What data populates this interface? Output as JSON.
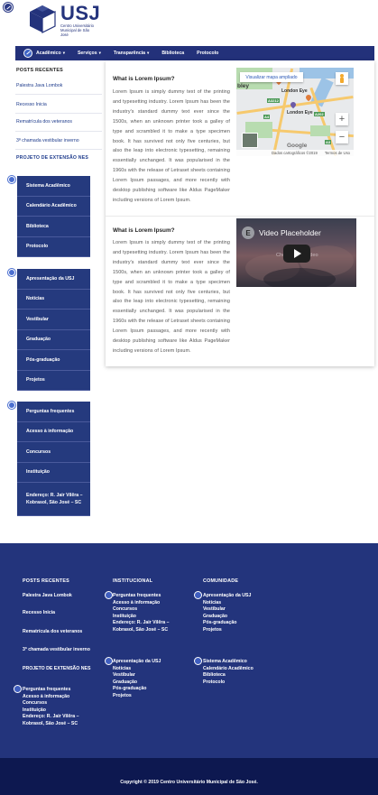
{
  "logo": {
    "abbr": "USJ",
    "sub": "Centro Universitário Municipal de São José"
  },
  "nav": {
    "items": [
      {
        "label": "Acadêmico",
        "dropdown": true
      },
      {
        "label": "Serviços",
        "dropdown": true
      },
      {
        "label": "Transparência",
        "dropdown": true
      },
      {
        "label": "Biblioteca",
        "dropdown": false
      },
      {
        "label": "Protocolo",
        "dropdown": false
      }
    ]
  },
  "sidebar": {
    "recent_heading": "POSTS RECENTES",
    "recent_posts": [
      "Palestra Java Lombok",
      "Recesso Inicia",
      "Rematrícula dos veteranos",
      "3ª chamada vestibular inverno"
    ],
    "project_link": "PROJETO DE EXTENSÃO NES",
    "group1": [
      "Sistema Acadêmico",
      "Calendário Acadêmico",
      "Biblioteca",
      "Protocolo"
    ],
    "group2": [
      "Apresentação da USJ",
      "Notícias",
      "Vestibular",
      "Graduação",
      "Pós-graduação",
      "Projetos"
    ],
    "group3": [
      "Perguntas frequentes",
      "Acesso à informação",
      "Concursos",
      "Instituição",
      "Endereço: R. Jair Vilêra – Kobrasol, São José – SC"
    ]
  },
  "content": {
    "section1": {
      "title": "What is Lorem Ipsum?",
      "body": "Lorem Ipsum is simply dummy text of the printing and typesetting industry. Lorem Ipsum has been the industry's standard dummy text ever since the 1500s, when an unknown printer took a galley of type and scrambled it to make a type specimen book. It has survived not only five centuries, but also the leap into electronic typesetting, remaining essentially unchanged. It was popularised in the 1960s with the release of Letraset sheets containing Lorem Ipsum passages, and more recently with desktop publishing software like Aldus PageMaker including versions of Lorem Ipsum."
    },
    "section2": {
      "title": "What is Lorem Ipsum?",
      "body": "Lorem Ipsum is simply dummy text of the printing and typesetting industry. Lorem Ipsum has been the industry's standard dummy text ever since the 1500s, when an unknown printer took a galley of type and scrambled it to make a type specimen book. It has survived not only five centuries, but also the leap into electronic typesetting, remaining essentially unchanged. It was popularised in the 1960s with the release of Letraset sheets containing Lorem Ipsum passages, and more recently with desktop publishing software like Aldus PageMaker including versions of Lorem Ipsum."
    },
    "map": {
      "enlarge_label": "Visualizar mapa ampliado",
      "labels": [
        "bley",
        "London Eye",
        "London Eye"
      ],
      "road_labels": [
        "A3212",
        "A4",
        "A202",
        "A3"
      ],
      "zoom_in": "+",
      "zoom_out": "−",
      "brand": "Google",
      "attribution": "Dados cartográficos ©2019",
      "terms": "Termos de Uso"
    },
    "video": {
      "title": "Video Placeholder",
      "subtitle": "Choose your video",
      "logo_glyph": "E"
    }
  },
  "footer": {
    "col1": {
      "heading": "POSTS RECENTES",
      "posts": [
        "Palestra Java Lombok",
        "Recesso Inicia",
        "Rematrícula dos veteranos",
        "3ª chamada vestibular inverno"
      ],
      "project_link": "PROJETO DE EXTENSÃO NES",
      "links": [
        "Perguntas frequentes",
        "Acesso à informação",
        "Concursos",
        "Instituição",
        "Endereço: R. Jair Vilêra –",
        "Kobrasol, São José – SC"
      ]
    },
    "col2": {
      "heading": "INSTITUCIONAL",
      "links_a": [
        "Perguntas frequentes",
        "Acesso à informação",
        "Concursos",
        "Instituição",
        "Endereço: R. Jair Vilêra –",
        "Kobrasol, São José – SC"
      ],
      "links_b": [
        "Apresentação da USJ",
        "Notícias",
        "Vestibular",
        "Graduação",
        "Pós-graduação",
        "Projetos"
      ]
    },
    "col3": {
      "heading": "COMUNIDADE",
      "links_a": [
        "Apresentação da USJ",
        "Notícias",
        "Vestibular",
        "Graduação",
        "Pós-graduação",
        "Projetos"
      ],
      "links_b": [
        "Sistema Acadêmico",
        "Calendário Acadêmico",
        "Biblioteca",
        "Protocolo"
      ]
    },
    "copyright": "Copyright © 2019 Centro Universitário Municipal de São José."
  },
  "colors": {
    "brand": "#23317a",
    "footer": "#23347c",
    "footer_bottom": "#0d1850",
    "link": "#1f3c8c"
  }
}
